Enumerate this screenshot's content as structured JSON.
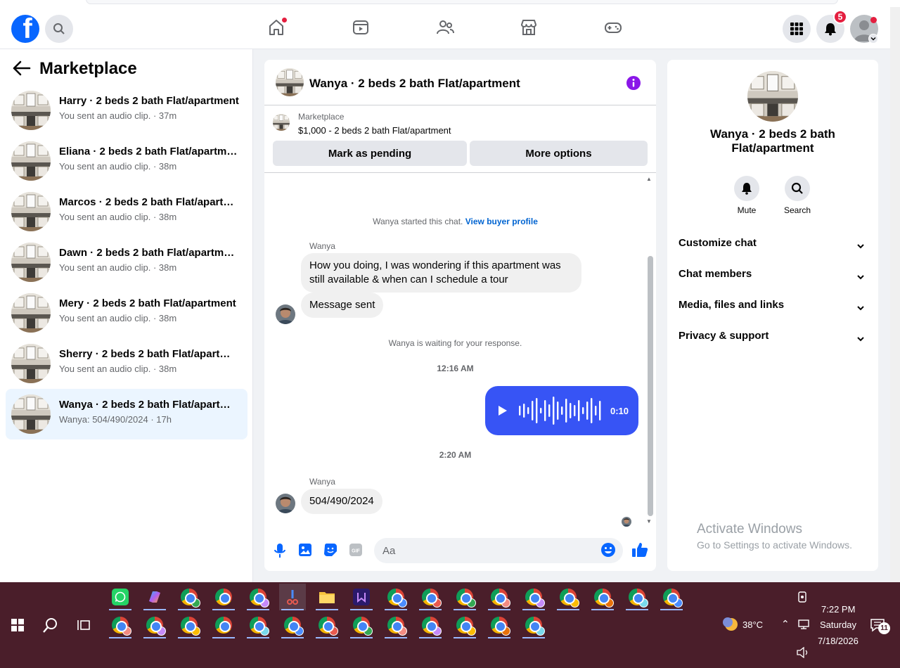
{
  "colors": {
    "fb_blue": "#0866ff",
    "link_blue": "#0064d1",
    "audio_bubble": "#3754f5",
    "badge_red": "#e41e3f",
    "info_purple": "#8a16e8",
    "active_row": "#ebf5ff",
    "taskbar": "#4a1e2a"
  },
  "nav": {
    "icons": [
      "facebook-logo",
      "search-icon",
      "home-icon",
      "video-icon",
      "friends-icon",
      "marketplace-icon",
      "gaming-icon",
      "menu-grid-icon",
      "notifications-icon",
      "profile-avatar"
    ],
    "notification_count": "5"
  },
  "sidebar": {
    "title": "Marketplace",
    "conversations": [
      {
        "name": "Harry · 2 beds 2 bath Flat/apartment",
        "sub": "You sent an audio clip. · 37m"
      },
      {
        "name": "Eliana · 2 beds 2 bath Flat/apartment",
        "sub": "You sent an audio clip. · 38m"
      },
      {
        "name": "Marcos · 2 beds 2 bath Flat/apartment",
        "sub": "You sent an audio clip. · 38m"
      },
      {
        "name": "Dawn · 2 beds 2 bath Flat/apartment",
        "sub": "You sent an audio clip. · 38m"
      },
      {
        "name": "Mery · 2 beds 2 bath Flat/apartment",
        "sub": "You sent an audio clip. · 38m"
      },
      {
        "name": "Sherry · 2 beds 2 bath Flat/apartment",
        "sub": "You sent an audio clip. · 38m"
      },
      {
        "name": "Wanya · 2 beds 2 bath Flat/apartment",
        "sub": "Wanya: 504/490/2024 · 17h"
      }
    ]
  },
  "chat": {
    "title": "Wanya · 2 beds 2 bath Flat/apartment",
    "listing": {
      "source": "Marketplace",
      "price_line": "$1,000 - 2 beds 2 bath Flat/apartment",
      "btn_pending": "Mark as pending",
      "btn_more": "More options"
    },
    "started_note": "Wanya started this chat.",
    "buyer_link": "View buyer profile",
    "sender": "Wanya",
    "msg1": "How you doing, I was wondering if this apartment was still available & when can I schedule a tour",
    "msg2": "Message sent",
    "waiting_note": "Wanya is waiting for your response.",
    "time1": "12:16 AM",
    "audio_duration": "0:10",
    "time2": "2:20 AM",
    "msg3": "504/490/2024",
    "composer_placeholder": "Aa"
  },
  "info": {
    "title": "Wanya · 2 beds 2 bath Flat/apartment",
    "mute": "Mute",
    "search": "Search",
    "sections": [
      "Customize chat",
      "Chat members",
      "Media, files and links",
      "Privacy & support"
    ]
  },
  "watermark": {
    "line1": "Activate Windows",
    "line2": "Go to Settings to activate Windows."
  },
  "tray": {
    "temp": "38°C",
    "time": "7:22 PM",
    "day": "Saturday",
    "date": "7/18/2026",
    "notif_count": "11"
  }
}
